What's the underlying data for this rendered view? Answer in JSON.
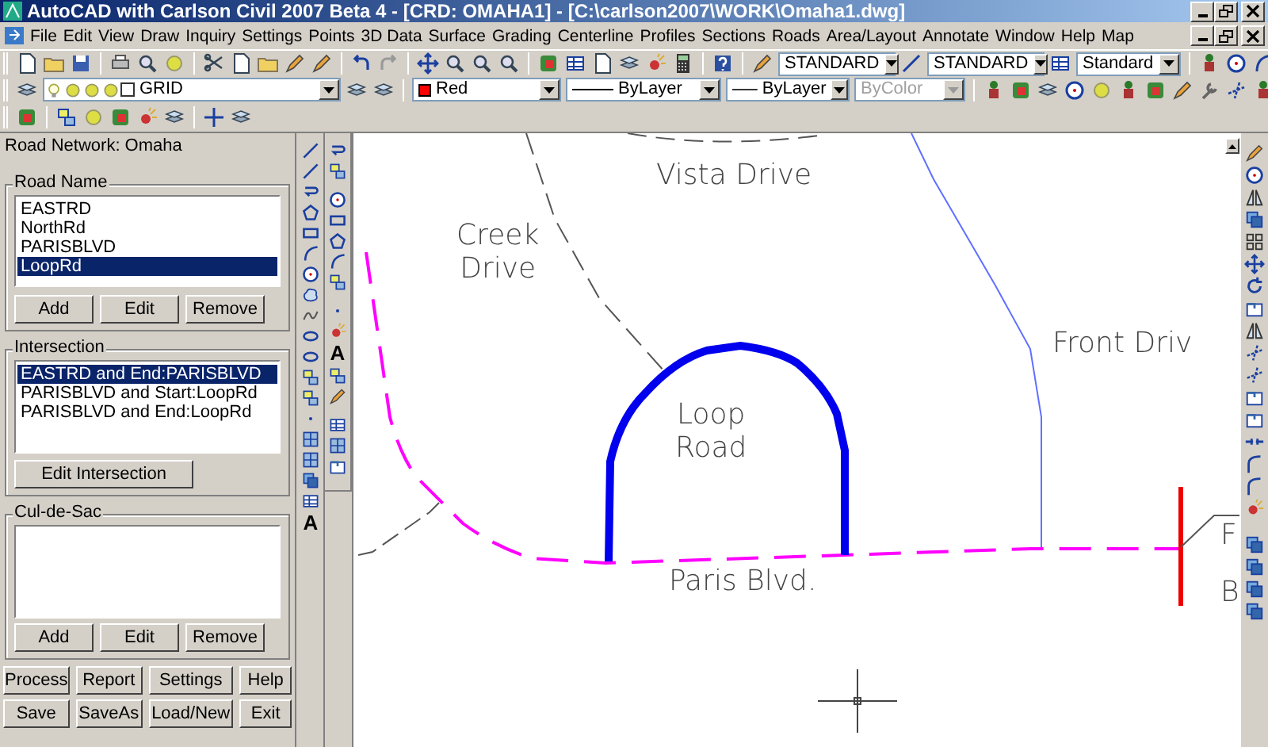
{
  "window": {
    "title": "AutoCAD with Carlson Civil 2007 Beta 4 - [CRD: OMAHA1] - [C:\\carlson2007\\WORK\\Omaha1.dwg]"
  },
  "menu": [
    "File",
    "Edit",
    "View",
    "Draw",
    "Inquiry",
    "Settings",
    "Points",
    "3D Data",
    "Surface",
    "Grading",
    "Centerline",
    "Profiles",
    "Sections",
    "Roads",
    "Area/Layout",
    "Annotate",
    "Window",
    "Help",
    "Map"
  ],
  "toolbar": {
    "text_style": "STANDARD",
    "dim_style": "STANDARD",
    "table_style": "Standard"
  },
  "properties": {
    "layer": "GRID",
    "color": {
      "value": "Red",
      "color": "#ff0000"
    },
    "linetype": "ByLayer",
    "lineweight": "ByLayer",
    "plot_style": {
      "value": "ByColor",
      "disabled": true
    }
  },
  "panel": {
    "title": "Road Network: Omaha",
    "road_name": {
      "label": "Road Name",
      "items": [
        {
          "text": "EASTRD",
          "selected": false
        },
        {
          "text": "NorthRd",
          "selected": false
        },
        {
          "text": "PARISBLVD",
          "selected": false
        },
        {
          "text": "LoopRd",
          "selected": true
        }
      ],
      "buttons": [
        "Add",
        "Edit",
        "Remove"
      ]
    },
    "intersection": {
      "label": "Intersection",
      "items": [
        {
          "text": "EASTRD and End:PARISBLVD",
          "selected": true
        },
        {
          "text": "PARISBLVD and Start:LoopRd",
          "selected": false
        },
        {
          "text": "PARISBLVD and End:LoopRd",
          "selected": false
        }
      ],
      "buttons": [
        "Edit Intersection"
      ]
    },
    "cul_de_sac": {
      "label": "Cul-de-Sac",
      "buttons": [
        "Add",
        "Edit",
        "Remove"
      ]
    },
    "footer_buttons": [
      [
        "Process",
        "Report",
        "Settings",
        "Help"
      ],
      [
        "Save",
        "SaveAs",
        "Load/New",
        "Exit"
      ]
    ]
  },
  "draw_toolbar": {
    "text_tool": "A"
  },
  "draw_toolbar_2": {
    "text_tool": "A"
  },
  "drawing": {
    "labels": [
      {
        "lines": [
          "Vista Drive"
        ]
      },
      {
        "lines": [
          "Creek",
          "Drive"
        ]
      },
      {
        "lines": [
          "Loop",
          "Road"
        ]
      },
      {
        "lines": [
          "Front Driv"
        ]
      },
      {
        "lines": [
          "Paris Blvd."
        ]
      },
      {
        "lines": [
          "F"
        ]
      },
      {
        "lines": [
          "B"
        ]
      }
    ]
  }
}
